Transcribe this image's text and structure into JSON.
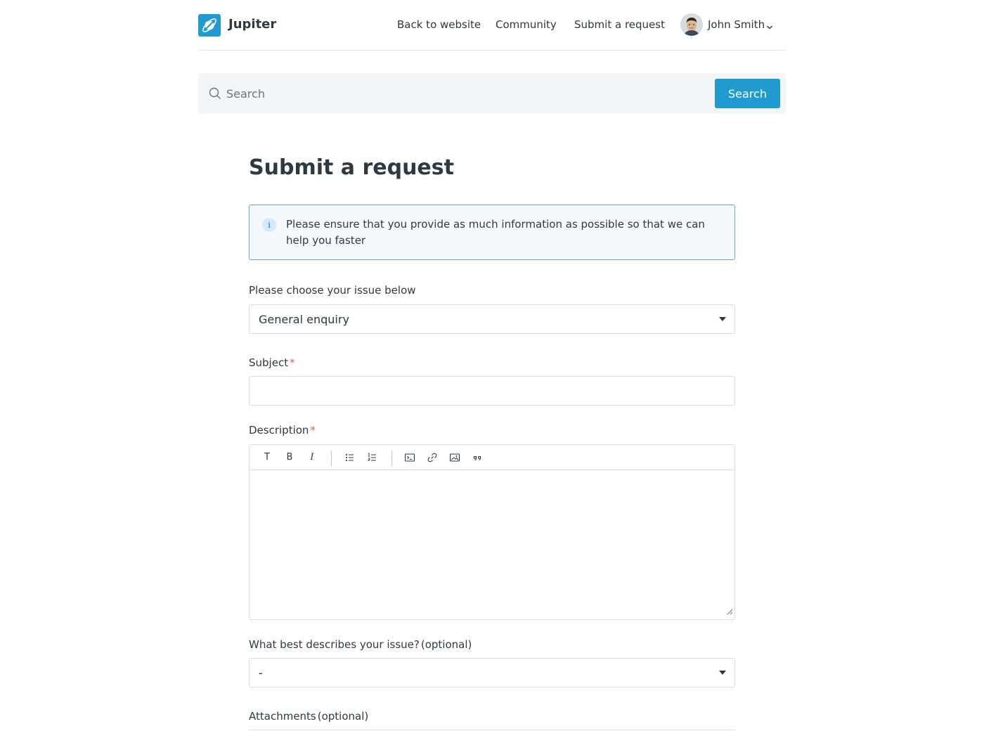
{
  "header": {
    "brand": "Jupiter",
    "nav": {
      "back": "Back to website",
      "community": "Community",
      "submit": "Submit a request"
    },
    "user": {
      "name": "John Smith"
    }
  },
  "search": {
    "placeholder": "Search",
    "button_label": "Search"
  },
  "page": {
    "title": "Submit a request",
    "notice": "Please ensure that you provide as much information as possible so that we can help you faster"
  },
  "form": {
    "issue": {
      "label": "Please choose your issue below",
      "value": "General enquiry"
    },
    "subject": {
      "label": "Subject",
      "required_mark": "*",
      "value": ""
    },
    "description": {
      "label": "Description",
      "required_mark": "*",
      "toolbar": {
        "text": "T",
        "bold": "B",
        "italic": "I"
      }
    },
    "category": {
      "label": "What best describes your issue?",
      "optional": "(optional)",
      "value": "-"
    },
    "attachments": {
      "label": "Attachments",
      "optional": "(optional)"
    }
  },
  "colors": {
    "accent": "#1f9bd1",
    "required": "#e35b66",
    "notice_border": "#5aa6e0"
  }
}
